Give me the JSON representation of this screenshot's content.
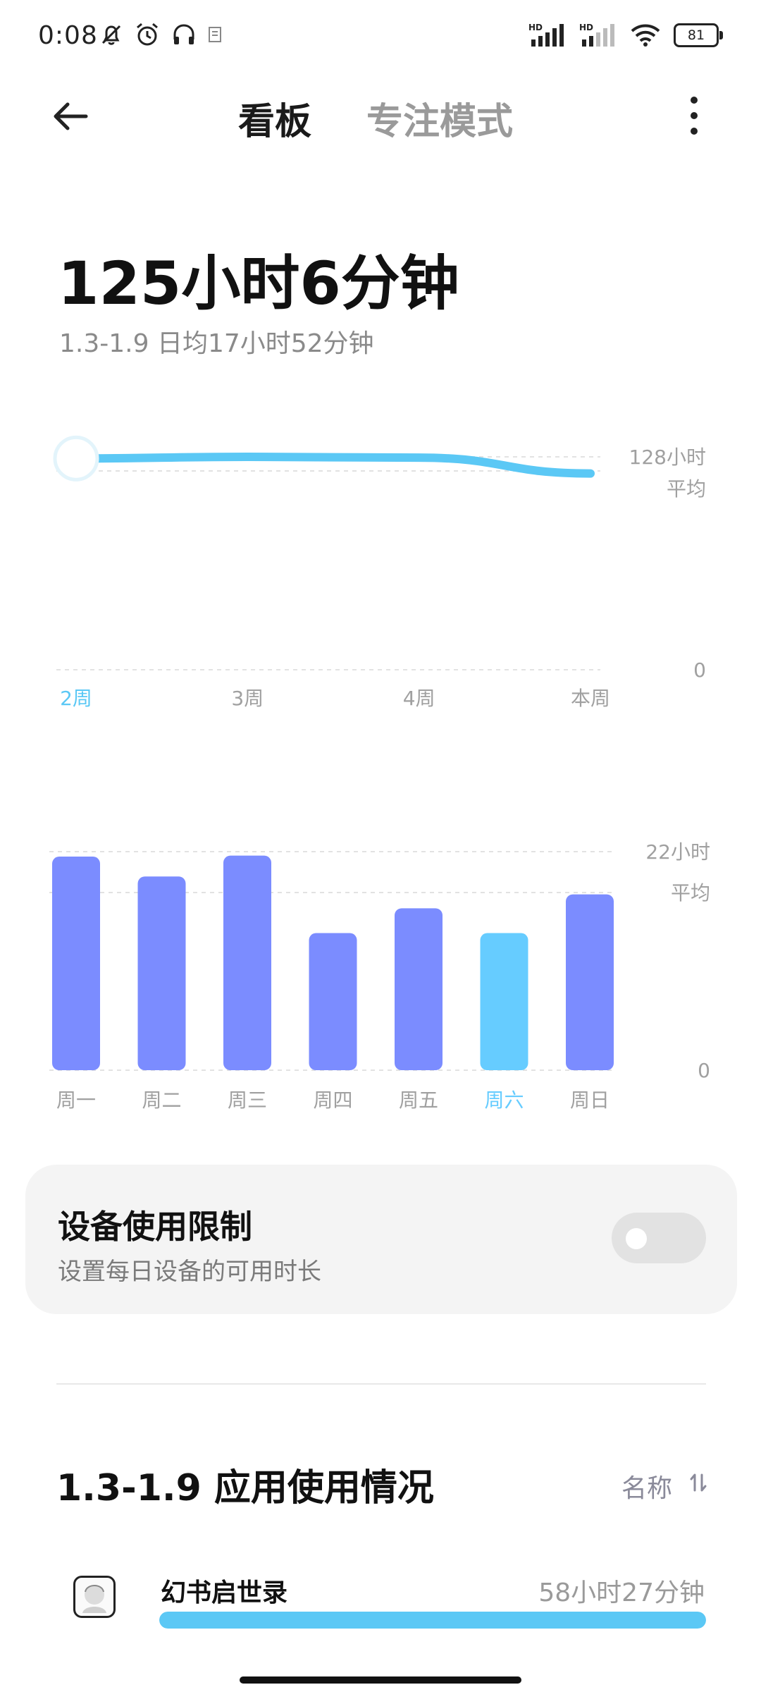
{
  "status_bar": {
    "time": "0:08",
    "battery": "81",
    "signal_1_label": "HD",
    "signal_2_label": "HD",
    "icons_left": [
      "mute-bell-icon",
      "alarm-icon",
      "headphones-icon",
      "notification-icon"
    ],
    "icons_right": [
      "signal-icon",
      "signal-icon",
      "wifi-icon",
      "battery-icon"
    ]
  },
  "header": {
    "tab_board": "看板",
    "tab_focus": "专注模式"
  },
  "summary": {
    "total": "125小时6分钟",
    "subtitle": "1.3-1.9 日均17小时52分钟"
  },
  "weekly_chart": {
    "max_label": "128小时",
    "avg_label": "平均",
    "zero_label": "0",
    "labels": [
      "2周",
      "3周",
      "4周",
      "本周"
    ],
    "selected": "2周",
    "accent": "#5bc8f5"
  },
  "daily_chart": {
    "max_label": "22小时",
    "avg_label": "平均",
    "zero_label": "0",
    "labels": [
      "周一",
      "周二",
      "周三",
      "周四",
      "周五",
      "周六",
      "周日"
    ],
    "selected": "周六",
    "bar_color": "#7b8cff",
    "selected_color": "#66ccff"
  },
  "chart_data": [
    {
      "type": "line",
      "x": [
        "2周",
        "3周",
        "4周",
        "本周"
      ],
      "series": [
        {
          "values": [
            127,
            128,
            127.5,
            118
          ]
        }
      ],
      "ylim": [
        0,
        128
      ],
      "y_tick_labels": [
        "0",
        "128小时"
      ],
      "average_label": "平均",
      "average_value": 125
    },
    {
      "type": "bar",
      "categories": [
        "周一",
        "周二",
        "周三",
        "周四",
        "周五",
        "周六",
        "周日"
      ],
      "values": [
        21.5,
        19.5,
        21.6,
        13.8,
        16.3,
        13.8,
        17.7
      ],
      "ylim": [
        0,
        22
      ],
      "y_tick_labels": [
        "0",
        "22小时"
      ],
      "average_label": "平均",
      "average_value": 17.87,
      "highlighted": "周六"
    }
  ],
  "limit_card": {
    "title": "设备使用限制",
    "description": "设置每日设备的可用时长",
    "enabled": false
  },
  "usage_section": {
    "title": "1.3-1.9 应用使用情况",
    "sort_label": "名称",
    "apps": [
      {
        "name": "幻书启世录",
        "time": "58小时27分钟",
        "fraction": 1.0,
        "icon": "app-avatar-icon"
      }
    ]
  }
}
